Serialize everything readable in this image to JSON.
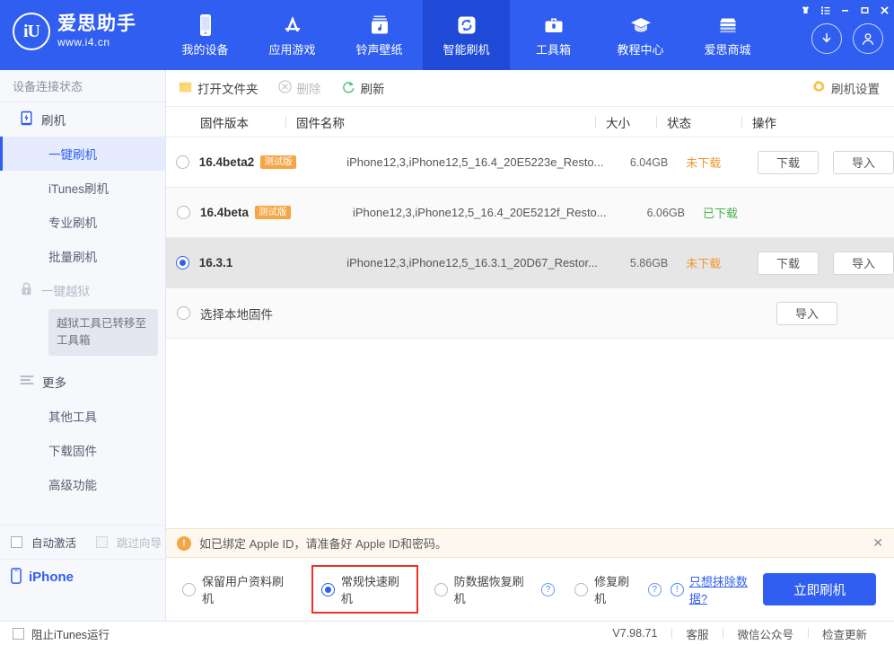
{
  "window": {
    "controls": [
      {
        "name": "skin-icon",
        "glyph": "♟"
      },
      {
        "name": "menu-icon",
        "glyph": "☰"
      },
      {
        "name": "minimize-icon",
        "glyph": "−"
      },
      {
        "name": "maximize-icon",
        "glyph": "☐"
      },
      {
        "name": "close-icon",
        "glyph": "✕"
      }
    ]
  },
  "brand": {
    "mark": "iU",
    "name": "爱思助手",
    "url": "www.i4.cn"
  },
  "nav": {
    "items": [
      {
        "label": "我的设备",
        "icon": "phone-icon",
        "active": false
      },
      {
        "label": "应用游戏",
        "icon": "appstore-icon",
        "active": false
      },
      {
        "label": "铃声壁纸",
        "icon": "music-icon",
        "active": false
      },
      {
        "label": "智能刷机",
        "icon": "refresh-square-icon",
        "active": true
      },
      {
        "label": "工具箱",
        "icon": "toolbox-icon",
        "active": false
      },
      {
        "label": "教程中心",
        "icon": "graduation-cap-icon",
        "active": false
      },
      {
        "label": "爱思商城",
        "icon": "shop-icon",
        "active": false
      }
    ],
    "download_icon": "download-circle-icon",
    "account_icon": "account-circle-icon"
  },
  "sidebar": {
    "status": "设备连接状态",
    "group_flash": "刷机",
    "items": [
      {
        "label": "一键刷机",
        "active": true
      },
      {
        "label": "iTunes刷机",
        "active": false
      },
      {
        "label": "专业刷机",
        "active": false
      },
      {
        "label": "批量刷机",
        "active": false
      }
    ],
    "jailbreak_label": "一键越狱",
    "jailbreak_tip": "越狱工具已转移至工具箱",
    "group_more": "更多",
    "more_items": [
      {
        "label": "其他工具"
      },
      {
        "label": "下载固件"
      },
      {
        "label": "高级功能"
      }
    ],
    "auto_activate": "自动激活",
    "skip_wizard": "跳过向导",
    "device": "iPhone"
  },
  "toolbar": {
    "open_folder": "打开文件夹",
    "delete": "删除",
    "refresh": "刷新",
    "settings": "刷机设置"
  },
  "table": {
    "headers": [
      "固件版本",
      "固件名称",
      "大小",
      "状态",
      "操作"
    ],
    "rows": [
      {
        "selected": false,
        "version": "16.4beta2",
        "tag": "测试版",
        "filename": "iPhone12,3,iPhone12,5_16.4_20E5223e_Resto...",
        "size": "6.04GB",
        "status": "未下载",
        "status_kind": "not-downloaded",
        "actions": [
          "下载",
          "导入"
        ]
      },
      {
        "selected": false,
        "version": "16.4beta",
        "tag": "测试版",
        "filename": "iPhone12,3,iPhone12,5_16.4_20E5212f_Resto...",
        "size": "6.06GB",
        "status": "已下载",
        "status_kind": "downloaded",
        "actions": []
      },
      {
        "selected": true,
        "version": "16.3.1",
        "tag": "",
        "filename": "iPhone12,3,iPhone12,5_16.3.1_20D67_Restor...",
        "size": "5.86GB",
        "status": "未下载",
        "status_kind": "not-downloaded",
        "actions": [
          "下载",
          "导入"
        ]
      },
      {
        "selected": false,
        "version": "选择本地固件",
        "tag": "",
        "filename": "",
        "size": "",
        "status": "",
        "status_kind": "",
        "actions": [
          "导入"
        ]
      }
    ]
  },
  "notice": {
    "text": "如已绑定 Apple ID，请准备好 Apple ID和密码。",
    "close": "✕"
  },
  "options": {
    "items": [
      {
        "label": "保留用户资料刷机",
        "selected": false,
        "help": false,
        "boxed": false
      },
      {
        "label": "常规快速刷机",
        "selected": true,
        "help": false,
        "boxed": true
      },
      {
        "label": "防数据恢复刷机",
        "selected": false,
        "help": true,
        "boxed": false
      },
      {
        "label": "修复刷机",
        "selected": false,
        "help": true,
        "boxed": false
      }
    ],
    "erase_link": "只想抹除数据?",
    "flash_button": "立即刷机"
  },
  "footer": {
    "block_itunes": "阻止iTunes运行",
    "version": "V7.98.71",
    "links": [
      "客服",
      "微信公众号",
      "检查更新"
    ]
  },
  "colors": {
    "brand_blue": "#2f5ef0",
    "nav_active": "#1f4ad8",
    "orange": "#f0982d",
    "green": "#4caf50",
    "red_box": "#ee3124"
  }
}
